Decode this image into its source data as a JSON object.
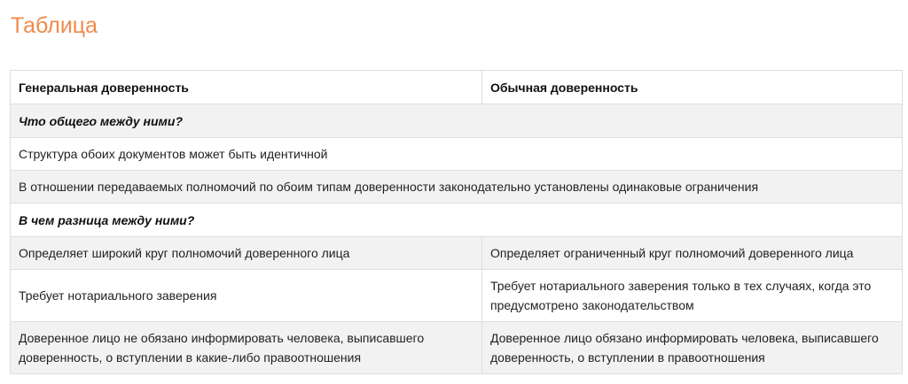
{
  "page": {
    "title": "Таблица"
  },
  "table": {
    "headers": [
      "Генеральная доверенность",
      "Обычная доверенность"
    ],
    "section_common": "Что общего между ними?",
    "common_rows": [
      "Структура обоих документов может быть идентичной",
      "В отношении передаваемых полномочий по обоим типам доверенности законодательно установлены одинаковые ограничения"
    ],
    "section_diff": "В чем разница между ними?",
    "diff_rows": [
      {
        "general": "Определяет широкий круг полномочий доверенного лица",
        "ordinary": "Определяет ограниченный круг полномочий доверенного лица"
      },
      {
        "general": "Требует нотариального заверения",
        "ordinary": "Требует нотариального заверения только в тех случаях, когда это предусмотрено законодательством"
      },
      {
        "general": "Доверенное лицо не обязано информировать человека, выписавшего доверенность, о вступлении в какие-либо правоотношения",
        "ordinary": "Доверенное лицо обязано информировать человека, выписавшего доверенность, о вступлении в правоотношения"
      }
    ]
  }
}
